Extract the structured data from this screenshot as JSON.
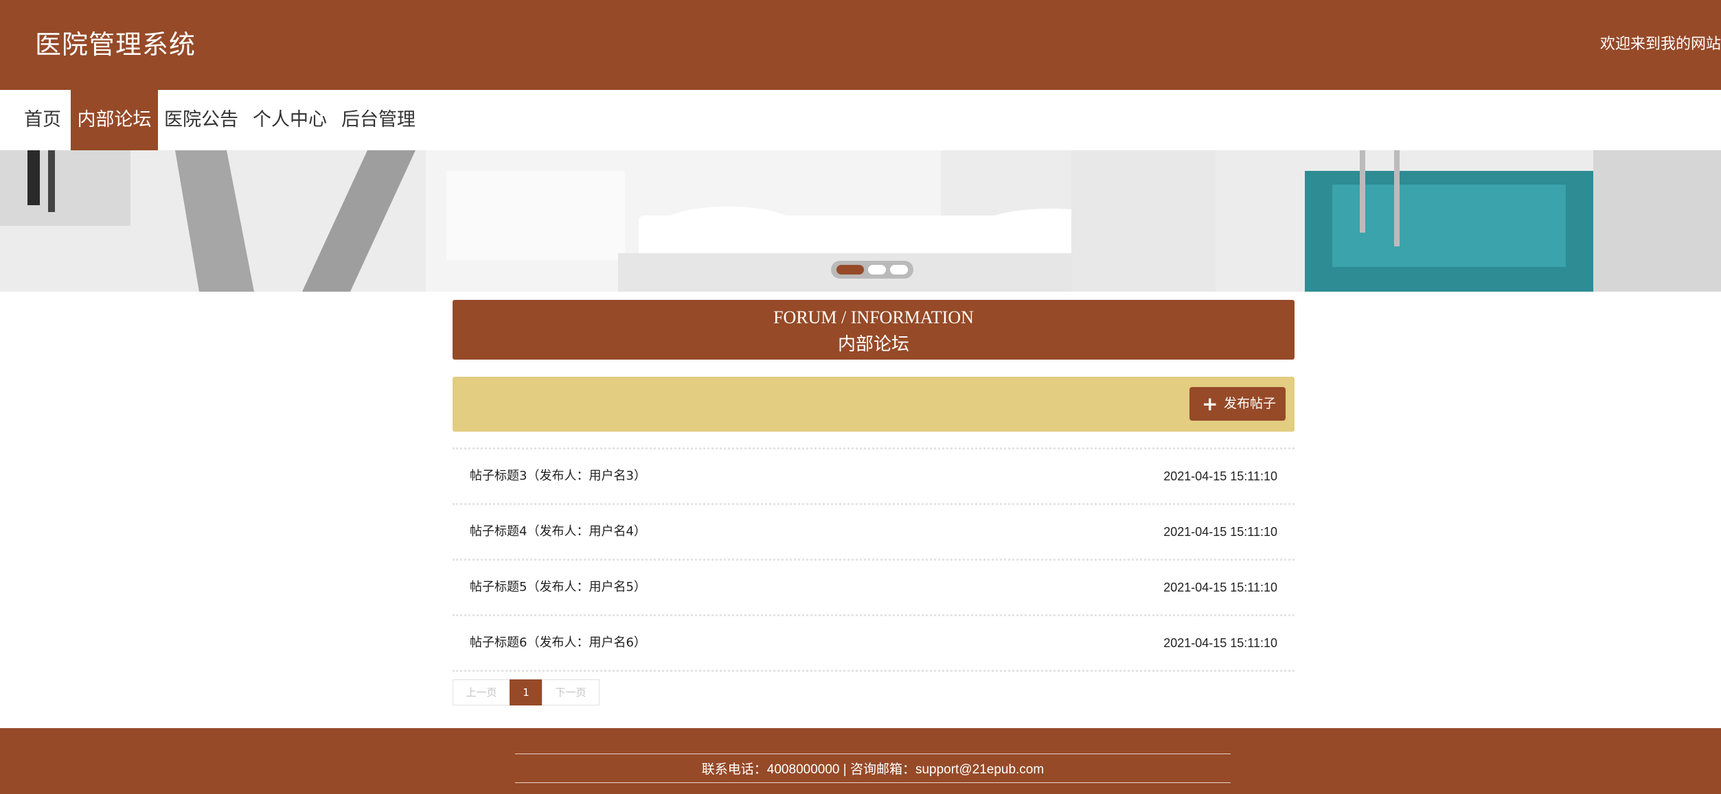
{
  "header": {
    "site_title": "医院管理系统",
    "welcome": "欢迎来到我的网站"
  },
  "nav": {
    "items": [
      {
        "label": "首页"
      },
      {
        "label": "内部论坛"
      },
      {
        "label": "医院公告"
      },
      {
        "label": "个人中心"
      },
      {
        "label": "后台管理"
      }
    ],
    "active": "内部论坛"
  },
  "banner": {
    "slide_count": 3,
    "active_slide": 1
  },
  "section": {
    "title_en": "FORUM / INFORMATION",
    "title_cn": "内部论坛"
  },
  "toolbar": {
    "post_icon": "plus-icon",
    "post_label": "发布帖子"
  },
  "posts": [
    {
      "title": "帖子标题3（发布人：用户名3）",
      "time": "2021-04-15 15:11:10"
    },
    {
      "title": "帖子标题4（发布人：用户名4）",
      "time": "2021-04-15 15:11:10"
    },
    {
      "title": "帖子标题5（发布人：用户名5）",
      "time": "2021-04-15 15:11:10"
    },
    {
      "title": "帖子标题6（发布人：用户名6）",
      "time": "2021-04-15 15:11:10"
    }
  ],
  "pagination": {
    "prev": "上一页",
    "current": "1",
    "next": "下一页"
  },
  "footer": {
    "contact": "联系电话：4008000000 | 咨询邮箱：support@21epub.com"
  },
  "colors": {
    "brand": "#964a28",
    "toolbar_bg": "#e2cd80"
  }
}
